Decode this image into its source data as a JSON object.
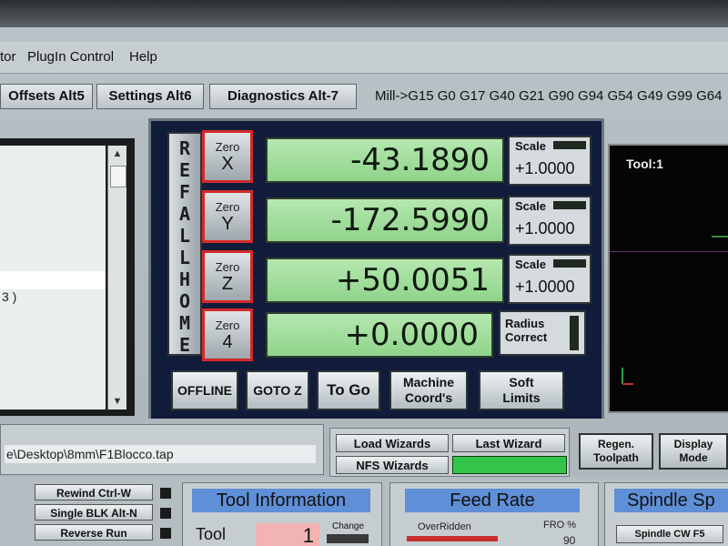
{
  "menu": [
    "tor",
    "PlugIn Control",
    "Help"
  ],
  "tabs": [
    "Offsets Alt5",
    "Settings Alt6",
    "Diagnostics Alt-7"
  ],
  "gcode_status": "Mill->G15  G0 G17 G40 G21 G90 G94 G54 G49 G99 G64",
  "left_list": {
    "text": "3 )"
  },
  "ref_all_home": [
    "R",
    "E",
    "F",
    "A",
    "L",
    "L",
    "H",
    "O",
    "M",
    "E"
  ],
  "axes": [
    {
      "zero_top": "Zero",
      "zero_axis": "X",
      "value": "-43.1890",
      "scale_label": "Scale",
      "scale_value": "+1.0000"
    },
    {
      "zero_top": "Zero",
      "zero_axis": "Y",
      "value": "-172.5990",
      "scale_label": "Scale",
      "scale_value": "+1.0000"
    },
    {
      "zero_top": "Zero",
      "zero_axis": "Z",
      "value": "+50.0051",
      "scale_label": "Scale",
      "scale_value": "+1.0000"
    },
    {
      "zero_top": "Zero",
      "zero_axis": "4",
      "value": "+0.0000"
    }
  ],
  "radius": {
    "line1": "Radius",
    "line2": "Correct"
  },
  "dro_buttons": {
    "offline": "OFFLINE",
    "goto_z": "GOTO Z",
    "to_go": "To Go",
    "machine_line1": "Machine",
    "machine_line2": "Coord's",
    "soft_line1": "Soft",
    "soft_line2": "Limits"
  },
  "toolpath": {
    "title": "Tool:1"
  },
  "file_path": "e\\Desktop\\8mm\\F1Blocco.tap",
  "wizards": {
    "load": "Load Wizards",
    "last": "Last Wizard",
    "nfs": "NFS Wizards"
  },
  "regen": {
    "line1": "Regen.",
    "line2": "Toolpath"
  },
  "display_mode": {
    "line1": "Display",
    "line2": "Mode"
  },
  "lower_buttons": [
    "Rewind Ctrl-W",
    "Single BLK Alt-N",
    "Reverse Run"
  ],
  "tool_info": {
    "header": "Tool Information",
    "tool_label": "Tool",
    "tool_number": "1",
    "change_label": "Change"
  },
  "feed_rate": {
    "header": "Feed Rate",
    "overridden": "OverRidden",
    "fro": "FRO %",
    "fro_value": "90"
  },
  "spindle": {
    "header": "Spindle Sp",
    "cw": "Spindle CW F5"
  }
}
